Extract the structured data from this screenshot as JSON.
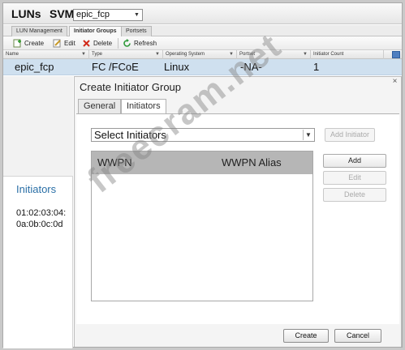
{
  "header": {
    "luns_label": "LUNs",
    "svm_label": "SVM",
    "svm_value": "epic_fcp"
  },
  "tabs": [
    {
      "label": "LUN Management"
    },
    {
      "label": "Initiator Groups"
    },
    {
      "label": "Portsets"
    }
  ],
  "toolbar": {
    "create_label": "Create",
    "edit_label": "Edit",
    "delete_label": "Delete",
    "refresh_label": "Refresh"
  },
  "grid": {
    "columns": [
      "Name",
      "Type",
      "Operating System",
      "Portset",
      "Initiator Count"
    ],
    "row": {
      "name": "epic_fcp",
      "type": "FC /FCoE",
      "os": "Linux",
      "portset": "-NA-",
      "count": "1"
    }
  },
  "left_panel": {
    "heading": "Initiators",
    "value_line1": "01:02:03:04:",
    "value_line2": "0a:0b:0c:0d"
  },
  "dialog": {
    "title": "Create Initiator Group",
    "tabs": [
      "General",
      "Initiators"
    ],
    "select_initiators": "Select Initiators",
    "add_initiator_label": "Add Initiator",
    "table_headers": [
      "WWPN",
      "WWPN Alias"
    ],
    "add_label": "Add",
    "edit_label": "Edit",
    "delete_label": "Delete",
    "create_label": "Create",
    "cancel_label": "Cancel"
  },
  "watermark": "freecram.net"
}
